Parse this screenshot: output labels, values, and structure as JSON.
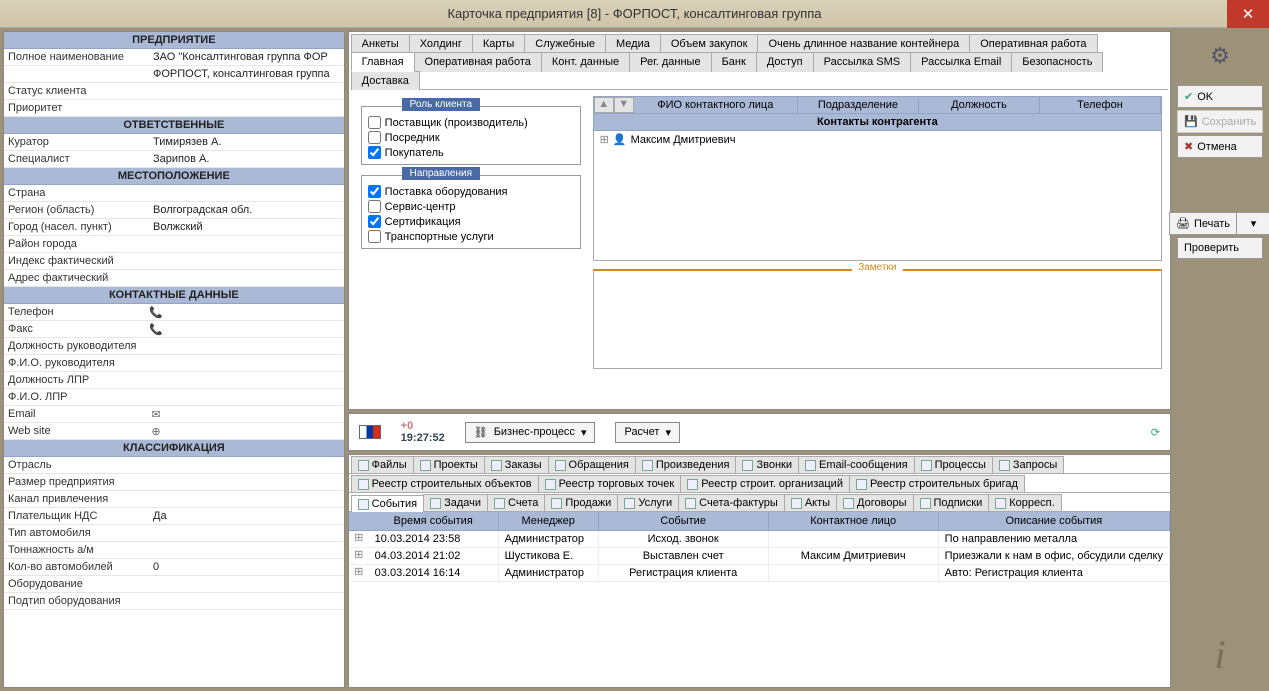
{
  "title": "Карточка предприятия [8] - ФОРПОСТ, консалтинговая группа",
  "left": {
    "s1": {
      "title": "ПРЕДПРИЯТИЕ",
      "rows": [
        {
          "l": "Полное наименование",
          "v": "ЗАО \"Консалтинговая группа ФОР"
        },
        {
          "l": "",
          "v": "ФОРПОСТ, консалтинговая группа"
        },
        {
          "l": "Статус клиента",
          "v": ""
        },
        {
          "l": "Приоритет",
          "v": ""
        }
      ]
    },
    "s2": {
      "title": "ОТВЕТСТВЕННЫЕ",
      "rows": [
        {
          "l": "Куратор",
          "v": "Тимирязев А."
        },
        {
          "l": "Специалист",
          "v": "Зарипов А."
        }
      ]
    },
    "s3": {
      "title": "МЕСТОПОЛОЖЕНИЕ",
      "rows": [
        {
          "l": "Страна",
          "v": ""
        },
        {
          "l": "Регион (область)",
          "v": "Волгоградская обл."
        },
        {
          "l": "Город (насел. пункт)",
          "v": "Волжский"
        },
        {
          "l": "Район города",
          "v": ""
        },
        {
          "l": "Индекс фактический",
          "v": ""
        },
        {
          "l": "Адрес фактический",
          "v": ""
        }
      ]
    },
    "s4": {
      "title": "КОНТАКТНЫЕ ДАННЫЕ",
      "rows": [
        {
          "l": "Телефон",
          "v": "",
          "ic": "📞"
        },
        {
          "l": "Факс",
          "v": "",
          "ic": "📞"
        },
        {
          "l": "Должность руководителя",
          "v": ""
        },
        {
          "l": "Ф.И.О. руководителя",
          "v": ""
        },
        {
          "l": "Должность ЛПР",
          "v": ""
        },
        {
          "l": "Ф.И.О. ЛПР",
          "v": ""
        },
        {
          "l": "Email",
          "v": "",
          "ic": "✉"
        },
        {
          "l": "Web site",
          "v": "",
          "ic": "⊕"
        }
      ]
    },
    "s5": {
      "title": "КЛАССИФИКАЦИЯ",
      "rows": [
        {
          "l": "Отрасль",
          "v": ""
        },
        {
          "l": "Размер предприятия",
          "v": ""
        },
        {
          "l": "Канал привлечения",
          "v": ""
        },
        {
          "l": "Плательщик НДС",
          "v": "Да"
        },
        {
          "l": "Тип автомобиля",
          "v": ""
        },
        {
          "l": "Тоннажность а/м",
          "v": ""
        },
        {
          "l": "Кол-во автомобилей",
          "v": "0"
        },
        {
          "l": "Оборудование",
          "v": ""
        },
        {
          "l": "Подтип оборудования",
          "v": ""
        }
      ]
    }
  },
  "topTabs1": [
    "Анкеты",
    "Холдинг",
    "Карты",
    "Служебные",
    "Медиа",
    "Объем закупок",
    "Очень длинное название контейнера",
    "Оперативная работа"
  ],
  "topTabs2": [
    "Главная",
    "Оперативная работа",
    "Конт. данные",
    "Рег. данные",
    "Банк",
    "Доступ",
    "Рассылка SMS",
    "Рассылка Email",
    "Безопасность",
    "Доставка"
  ],
  "role": {
    "title": "Роль клиента",
    "items": [
      {
        "l": "Поставщик (производитель)",
        "c": false
      },
      {
        "l": "Посредник",
        "c": false
      },
      {
        "l": "Покупатель",
        "c": true
      }
    ]
  },
  "dir": {
    "title": "Направления",
    "items": [
      {
        "l": "Поставка оборудования",
        "c": true
      },
      {
        "l": "Сервис-центр",
        "c": false
      },
      {
        "l": "Сертификация",
        "c": true
      },
      {
        "l": "Транспортные услуги",
        "c": false
      }
    ]
  },
  "contactCols": [
    "ФИО контактного лица",
    "Подразделение",
    "Должность",
    "Телефон"
  ],
  "contactsTitle": "Контакты контрагента",
  "contactName": "Максим Дмитриевич",
  "notesTitle": "Заметки",
  "midbar": {
    "plus": "+0",
    "time": "19:27:52",
    "biz": "Бизнес-процесс",
    "calc": "Расчет"
  },
  "miniRow1": [
    "Файлы",
    "Проекты",
    "Заказы",
    "Обращения",
    "Произведения",
    "Звонки",
    "Email-сообщения",
    "Процессы",
    "Запросы"
  ],
  "miniRow2": [
    "Реестр строительных объектов",
    "Реестр торговых точек",
    "Реестр строит. организаций",
    "Реестр строительных бригад"
  ],
  "miniRow3": [
    "События",
    "Задачи",
    "Счета",
    "Продажи",
    "Услуги",
    "Счета-фактуры",
    "Акты",
    "Договоры",
    "Подписки",
    "Корресп."
  ],
  "gridCols": [
    "Время события",
    "Менеджер",
    "Событие",
    "Контактное лицо",
    "Описание события"
  ],
  "gridRows": [
    {
      "t": "10.03.2014 23:58",
      "m": "Администратор",
      "e": "Исход. звонок",
      "c": "",
      "d": "По направлению металла"
    },
    {
      "t": "04.03.2014 21:02",
      "m": "Шустикова Е.",
      "e": "Выставлен счет",
      "c": "Максим Дмитриевич",
      "d": "Приезжали к нам в офис, обсудили сделку"
    },
    {
      "t": "03.03.2014 16:14",
      "m": "Администратор",
      "e": "Регистрация клиента",
      "c": "",
      "d": "Авто: Регистрация клиента"
    }
  ],
  "side": {
    "ok": "OK",
    "save": "Сохранить",
    "cancel": "Отмена",
    "print": "Печать",
    "check": "Проверить"
  }
}
